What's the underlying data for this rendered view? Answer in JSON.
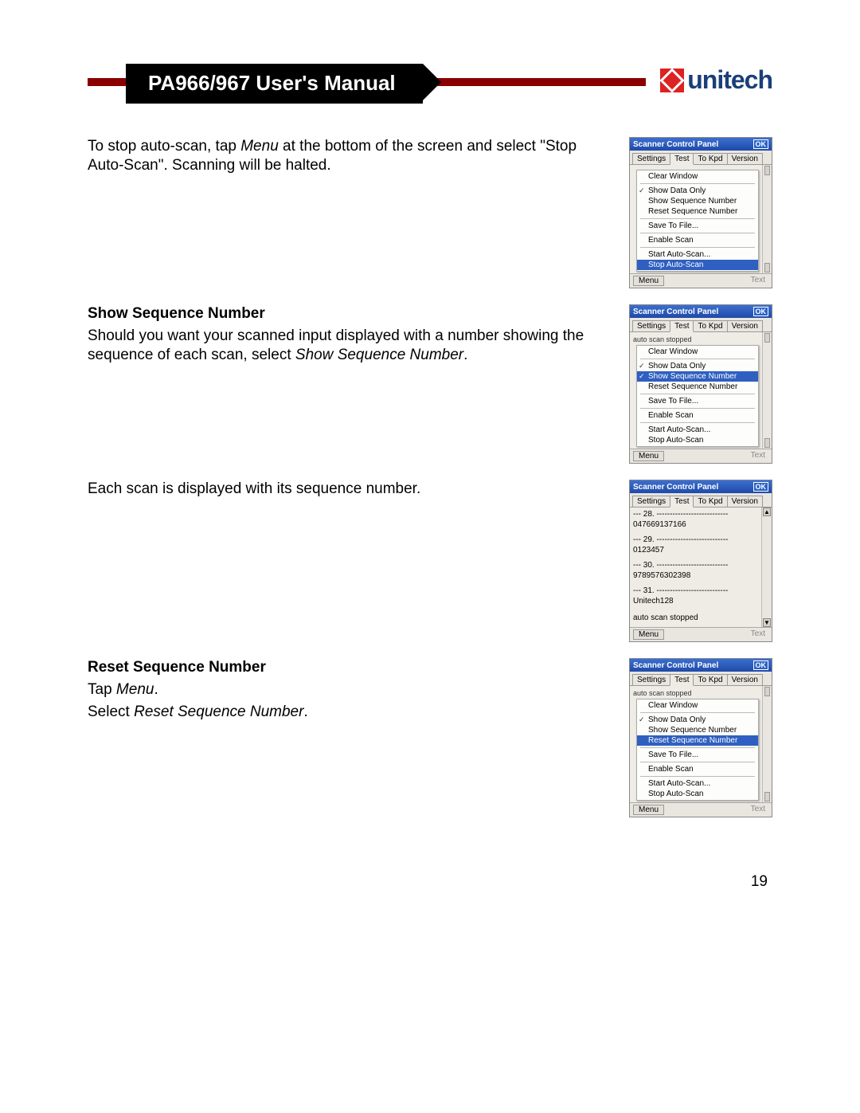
{
  "header": {
    "title": "PA966/967 User's Manual",
    "logo_text": "unitech"
  },
  "page_number": "19",
  "sections": [
    {
      "para1a": "To stop auto-scan, tap ",
      "para1b": "Menu",
      "para1c": " at the bottom of the screen and select \"Stop Auto-Scan\".  Scanning will be halted."
    },
    {
      "heading": "Show Sequence Number",
      "para_a": "Should you want your scanned input displayed with a number showing the sequence of each scan, select ",
      "para_b": "Show Sequence Number",
      "para_c": "."
    },
    {
      "para": "Each scan is displayed with its sequence number."
    },
    {
      "heading": "Reset Sequence Number",
      "line1a": "Tap ",
      "line1b": "Menu",
      "line1c": ".",
      "line2a": "Select ",
      "line2b": "Reset Sequence Number",
      "line2c": "."
    }
  ],
  "screenshot_common": {
    "title": "Scanner Control Panel",
    "ok": "OK",
    "tabs": [
      "Settings",
      "Test",
      "To Kpd",
      "Version"
    ],
    "active_tab": "Test",
    "foot_menu": "Menu",
    "foot_text": "Text"
  },
  "menu_items": {
    "clear_window": "Clear Window",
    "show_data_only": "Show Data Only",
    "show_seq": "Show Sequence Number",
    "reset_seq": "Reset Sequence Number",
    "save_file": "Save To File...",
    "enable_scan": "Enable Scan",
    "start_auto": "Start Auto-Scan...",
    "stop_auto": "Stop Auto-Scan"
  },
  "shot2_pretext": "auto scan stopped",
  "shot4_pretext": "auto scan stopped",
  "shot3_data": {
    "l1": "--- 28. ---------------------------",
    "l2": "047669137166",
    "l3": "--- 29. ---------------------------",
    "l4": "0123457",
    "l5": "--- 30. ---------------------------",
    "l6": "9789576302398",
    "l7": "--- 31. ---------------------------",
    "l8": "Unitech128",
    "l9": "auto scan stopped"
  }
}
